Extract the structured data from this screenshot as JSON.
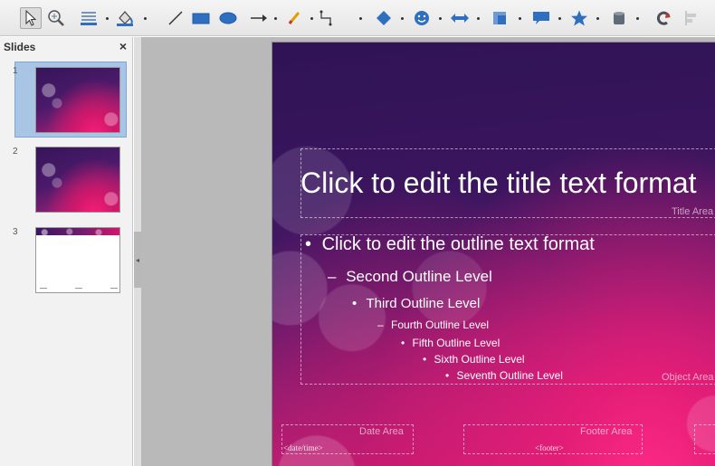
{
  "toolbar": {
    "tools": [
      "select-tool",
      "zoom-pan-tool",
      "line-color-tool",
      "area-fill-tool",
      "line-tool",
      "rectangle-tool",
      "ellipse-tool",
      "arrow-line-tool",
      "curve-tool",
      "connector-tool",
      "basic-shapes-tool",
      "symbol-shapes-tool",
      "block-arrows-tool",
      "flowchart-tool",
      "callouts-tool",
      "stars-tool",
      "3d-objects-tool",
      "rotate-tool",
      "align-tool"
    ],
    "accent": "#2e6fc0"
  },
  "panel": {
    "title": "Slides",
    "close": "×",
    "slides": [
      {
        "number": "1",
        "style": "pink",
        "selected": true
      },
      {
        "number": "2",
        "style": "pink",
        "selected": false
      },
      {
        "number": "3",
        "style": "white",
        "selected": false
      }
    ]
  },
  "slide": {
    "title": "Click to edit the title text format",
    "title_area_label": "Title Area for AutoLayouts",
    "outline": [
      {
        "level": 1,
        "bullet": "•",
        "text": "Click to edit the outline text format"
      },
      {
        "level": 2,
        "bullet": "–",
        "text": "Second Outline Level"
      },
      {
        "level": 3,
        "bullet": "•",
        "text": "Third Outline Level"
      },
      {
        "level": 4,
        "bullet": "–",
        "text": "Fourth Outline Level"
      },
      {
        "level": 5,
        "bullet": "•",
        "text": "Fifth Outline Level"
      },
      {
        "level": 6,
        "bullet": "•",
        "text": "Sixth Outline Level"
      },
      {
        "level": 7,
        "bullet": "•",
        "text": "Seventh Outline Level"
      }
    ],
    "object_area_label": "Object Area for AutoLayouts",
    "date_area_label": "Date Area",
    "date_field": "<date/time>",
    "footer_area_label": "Footer Area",
    "footer_field": "<footer>"
  }
}
